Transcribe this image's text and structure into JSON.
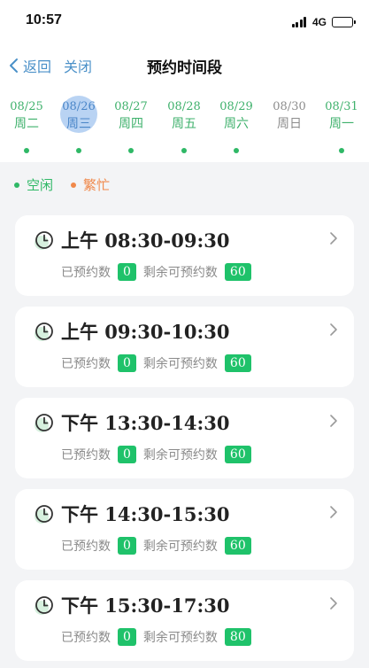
{
  "status_bar": {
    "time": "10:57",
    "network": "4G"
  },
  "nav": {
    "back_label": "返回",
    "close_label": "关闭",
    "title": "预约时间段"
  },
  "dates": [
    {
      "date": "08/25",
      "weekday": "周二",
      "state": "free",
      "dot": true
    },
    {
      "date": "08/26",
      "weekday": "周三",
      "state": "selected",
      "dot": true
    },
    {
      "date": "08/27",
      "weekday": "周四",
      "state": "free",
      "dot": true
    },
    {
      "date": "08/28",
      "weekday": "周五",
      "state": "free",
      "dot": true
    },
    {
      "date": "08/29",
      "weekday": "周六",
      "state": "free",
      "dot": true
    },
    {
      "date": "08/30",
      "weekday": "周日",
      "state": "off",
      "dot": false
    },
    {
      "date": "08/31",
      "weekday": "周一",
      "state": "free",
      "dot": true
    }
  ],
  "legend": {
    "free_label": "空闲",
    "busy_label": "繁忙"
  },
  "labels": {
    "booked": "已预约数",
    "remaining": "剩余可预约数"
  },
  "slots": [
    {
      "time": "上午 08:30-09:30",
      "booked": "0",
      "remaining": "60"
    },
    {
      "time": "上午 09:30-10:30",
      "booked": "0",
      "remaining": "60"
    },
    {
      "time": "下午 13:30-14:30",
      "booked": "0",
      "remaining": "60"
    },
    {
      "time": "下午 14:30-15:30",
      "booked": "0",
      "remaining": "60"
    },
    {
      "time": "下午 15:30-17:30",
      "booked": "0",
      "remaining": "80"
    }
  ],
  "colors": {
    "accent_green": "#1fc26a",
    "link_blue": "#4a90c8",
    "busy_orange": "#f0884a",
    "selected_circle": "#b9d3f3"
  }
}
